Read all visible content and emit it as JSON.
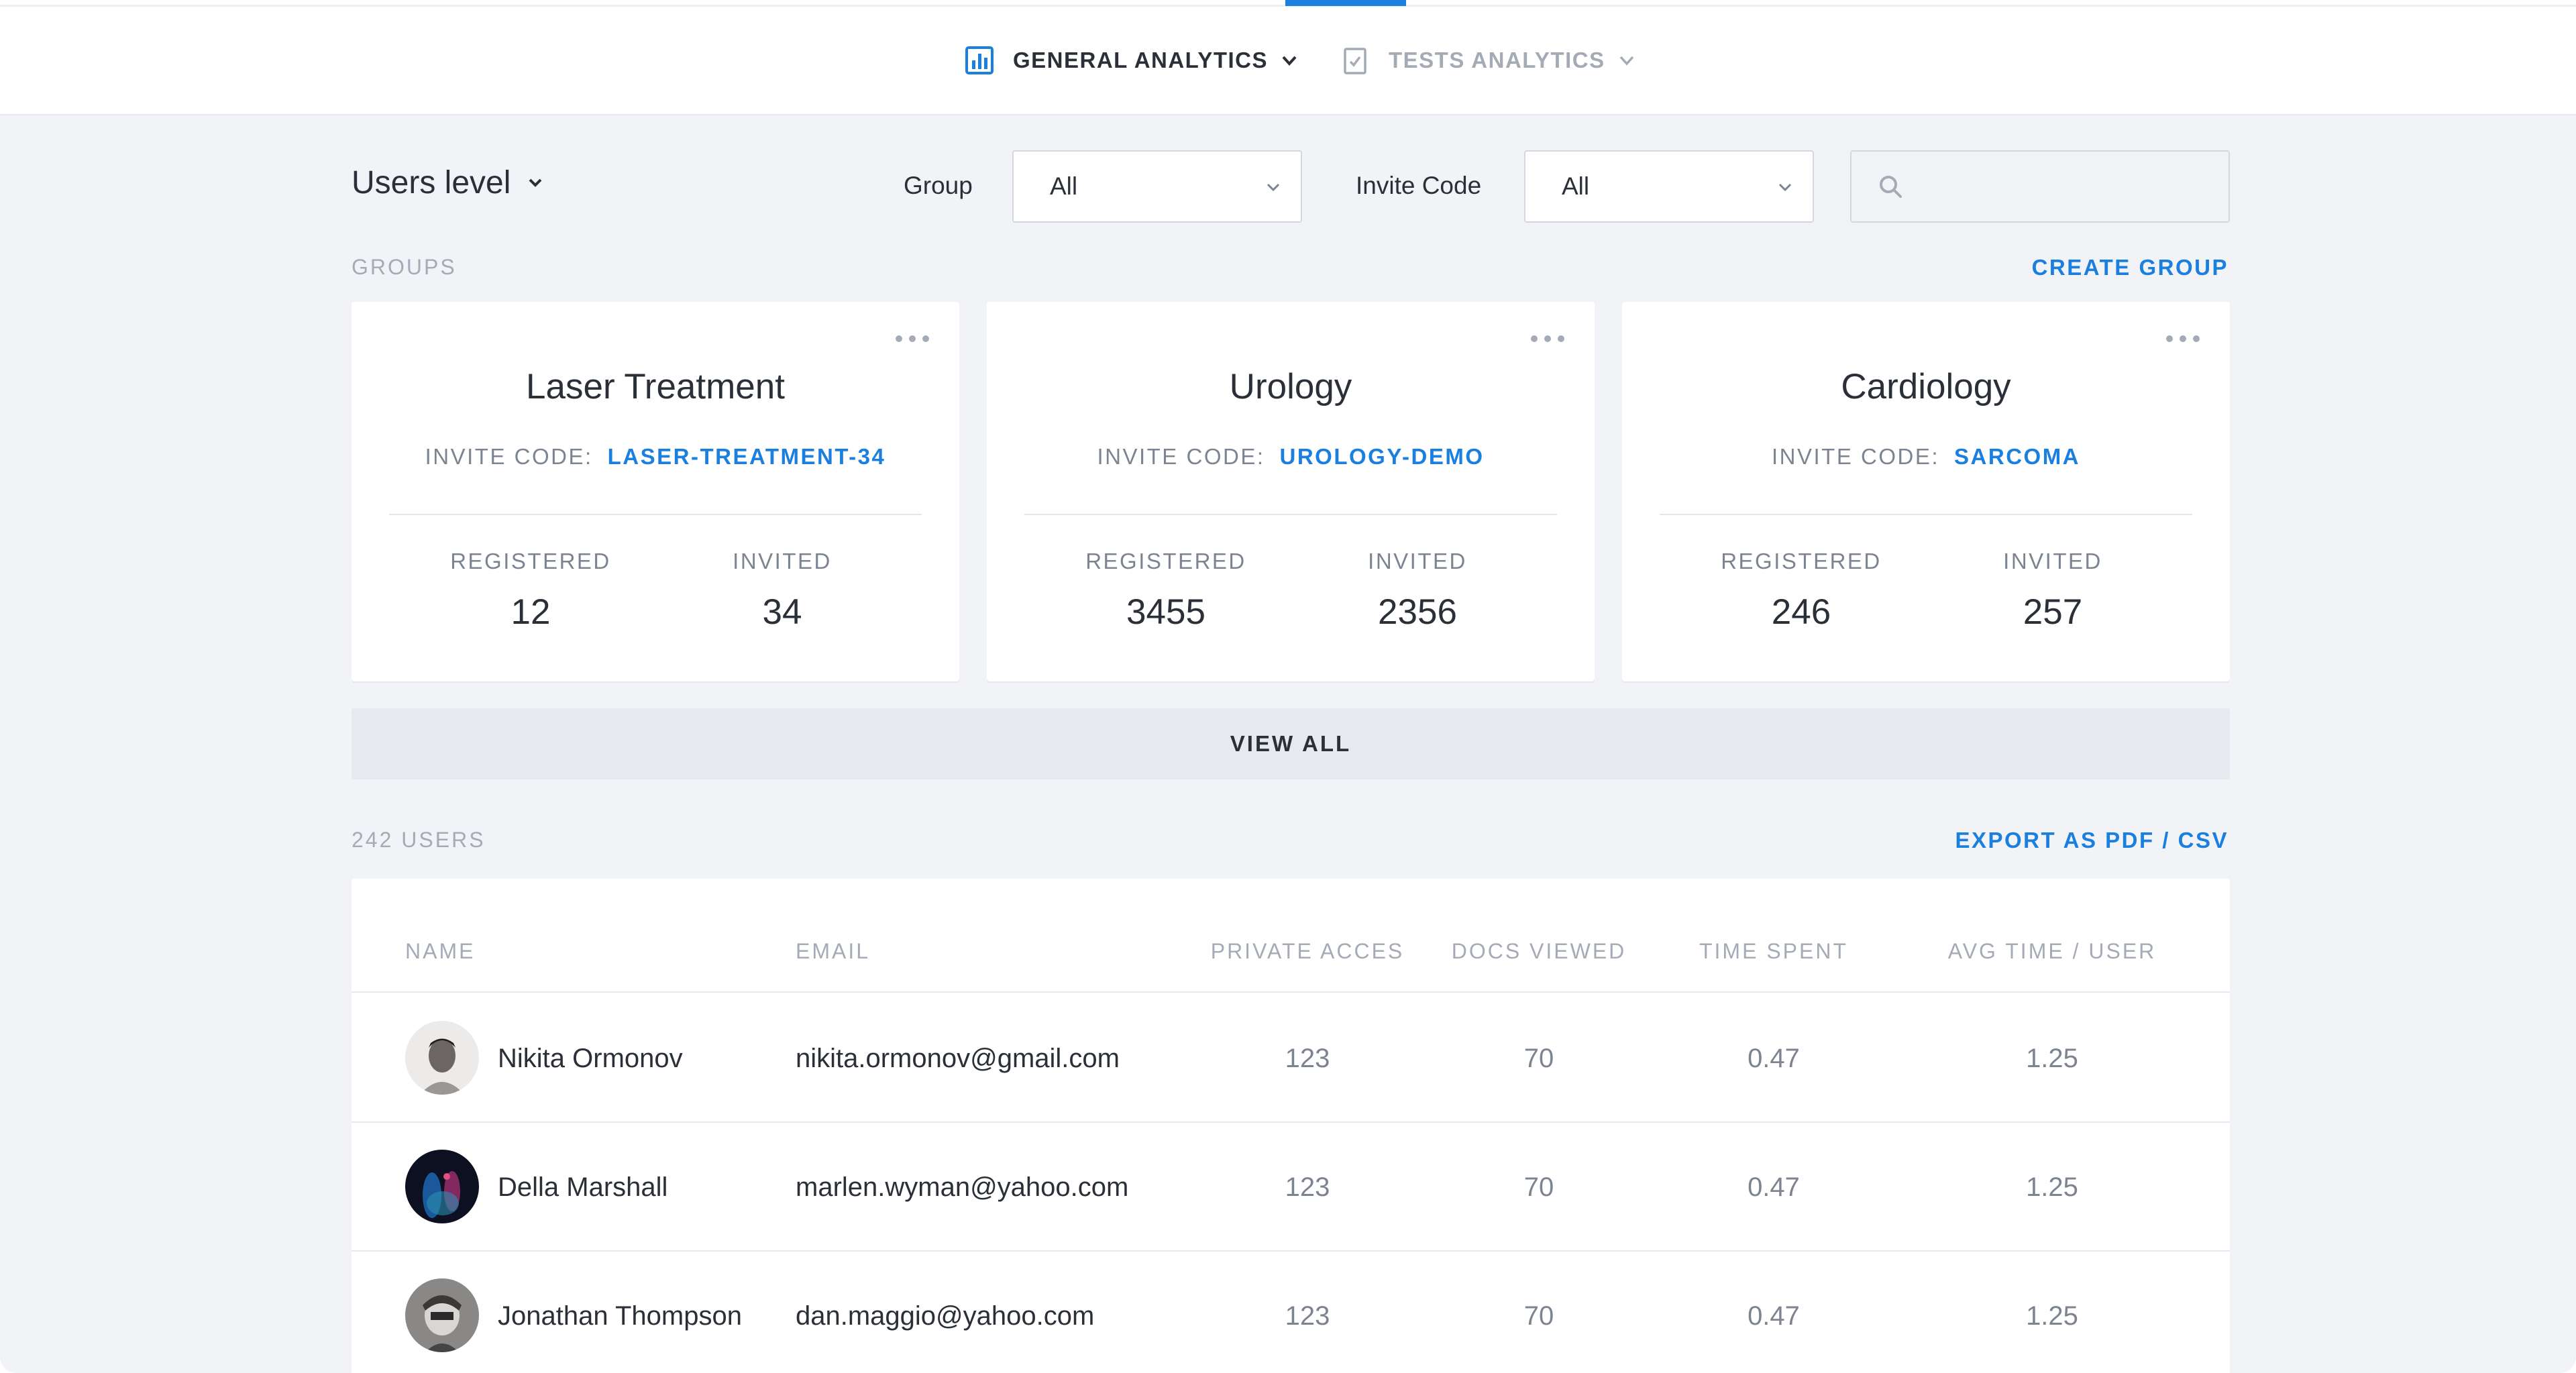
{
  "nav": {
    "general_label": "GENERAL ANALYTICS",
    "tests_label": "TESTS ANALYTICS",
    "active_color": "#1b7fe0"
  },
  "filters": {
    "users_level": "Users level",
    "group_label": "Group",
    "group_value": "All",
    "invite_label": "Invite Code",
    "invite_value": "All",
    "search_placeholder": ""
  },
  "groups": {
    "section_label": "GROUPS",
    "create_label": "CREATE GROUP",
    "invite_code_label": "INVITE CODE:",
    "registered_label": "REGISTERED",
    "invited_label": "INVITED",
    "view_all_label": "VIEW ALL",
    "items": [
      {
        "title": "Laser Treatment",
        "code": "LASER-TREATMENT-34",
        "registered": "12",
        "invited": "34"
      },
      {
        "title": "Urology",
        "code": "UROLOGY-DEMO",
        "registered": "3455",
        "invited": "2356"
      },
      {
        "title": "Cardiology",
        "code": "SARCOMA",
        "registered": "246",
        "invited": "257"
      }
    ]
  },
  "users": {
    "count_label": "242 USERS",
    "export_label": "EXPORT AS PDF / CSV",
    "columns": [
      "NAME",
      "EMAIL",
      "PRIVATE ACCES",
      "DOCS VIEWED",
      "TIME SPENT",
      "AVG TIME / USER"
    ],
    "rows": [
      {
        "name": "Nikita Ormonov",
        "email": "nikita.ormonov@gmail.com",
        "private": "123",
        "docs": "70",
        "time": "0.47",
        "avg": "1.25"
      },
      {
        "name": "Della Marshall",
        "email": "marlen.wyman@yahoo.com",
        "private": "123",
        "docs": "70",
        "time": "0.47",
        "avg": "1.25"
      },
      {
        "name": "Jonathan Thompson",
        "email": "dan.maggio@yahoo.com",
        "private": "123",
        "docs": "70",
        "time": "0.47",
        "avg": "1.25"
      }
    ]
  },
  "icons": {
    "general": "bar-chart-icon",
    "tests": "clipboard-check-icon",
    "search": "search-icon",
    "more": "more-horizontal-icon",
    "chevron": "chevron-down-icon"
  }
}
